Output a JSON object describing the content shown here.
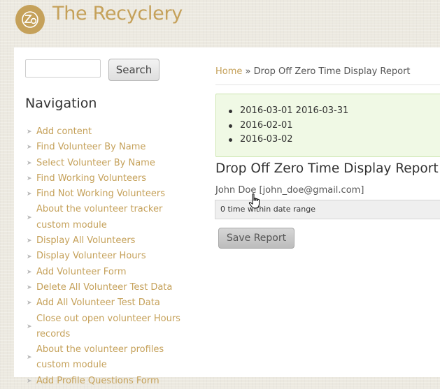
{
  "site": {
    "name": "The Recyclery",
    "logo_icon": "recyclery-logo-icon",
    "brand_color": "#c5a15a"
  },
  "search": {
    "button_label": "Search",
    "placeholder": ""
  },
  "navigation": {
    "title": "Navigation",
    "items": [
      "Add content",
      "Find Volunteer By Name",
      "Select Volunteer By Name",
      "Find Working Volunteers",
      "Find Not Working Volunteers",
      "About the volunteer tracker custom module",
      "Display All Volunteers",
      "Display Volunteer Hours",
      "Add Volunteer Form",
      "Delete All Volunteer Test Data",
      "Add All Volunteer Test Data",
      "Close out open volunteer Hours records",
      "About the volunteer profiles custom module",
      "Add Profile Questions Form"
    ]
  },
  "breadcrumb": {
    "home": "Home",
    "separator": "»",
    "current": "Drop Off Zero Time Display Report"
  },
  "messages": {
    "items": [
      "2016-03-01 2016-03-31",
      "2016-02-01",
      "2016-03-02"
    ],
    "background_color": "#f0f9e5"
  },
  "report": {
    "title": "Drop Off Zero Time Display Report",
    "user": "John Doe [john_doe@gmail.com]",
    "range_text": "0 time within date range",
    "save_label": "Save Report"
  }
}
